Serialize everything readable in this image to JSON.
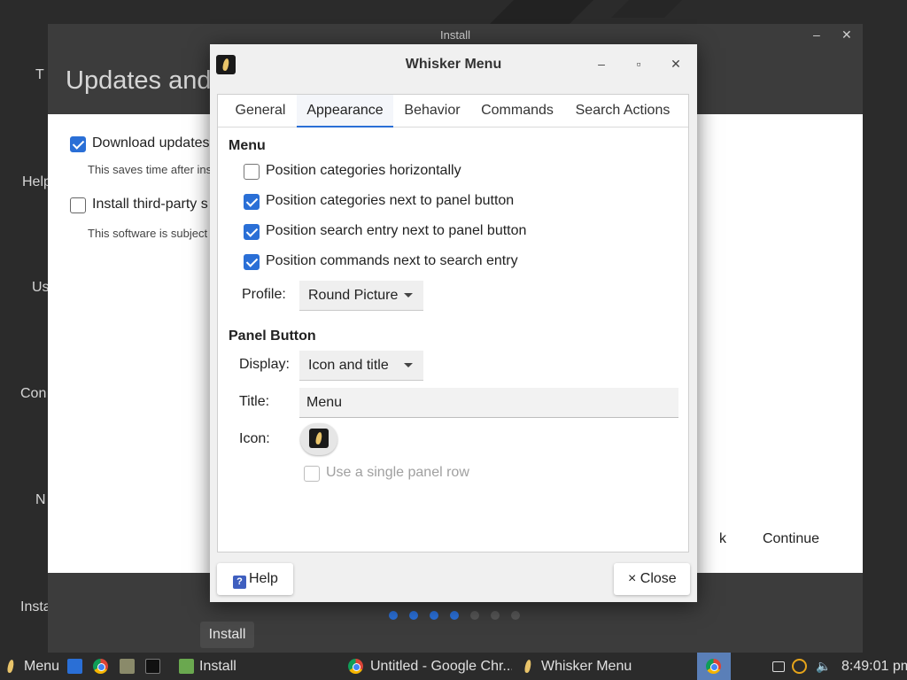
{
  "install_window": {
    "title": "Install",
    "minimize_glyph": "–",
    "close_glyph": "✕",
    "header": "Updates and",
    "options": [
      {
        "label": "Download updates",
        "checked": true,
        "desc": "This saves time after ins"
      },
      {
        "label": "Install third-party s",
        "checked": false,
        "desc": "This software is subject"
      }
    ],
    "back_label": "k",
    "continue_label": "Continue",
    "progress": {
      "total": 7,
      "current": 4
    }
  },
  "sidebar_fragments": [
    "T",
    "Help",
    "Us",
    "Con",
    "N",
    "Insta"
  ],
  "tooltip": "Install",
  "dialog": {
    "title": "Whisker Menu",
    "minimize_glyph": "–",
    "maximize_glyph": "▫",
    "close_glyph": "✕",
    "tabs": [
      "General",
      "Appearance",
      "Behavior",
      "Commands",
      "Search Actions"
    ],
    "active_tab": "Appearance",
    "menu_section": {
      "heading": "Menu",
      "options": [
        {
          "label": "Position categories horizontally",
          "checked": false
        },
        {
          "label": "Position categories next to panel button",
          "checked": true
        },
        {
          "label": "Position search entry next to panel button",
          "checked": true
        },
        {
          "label": "Position commands next to search entry",
          "checked": true
        }
      ],
      "profile_label": "Profile:",
      "profile_value": "Round Picture"
    },
    "panel_section": {
      "heading": "Panel Button",
      "display_label": "Display:",
      "display_value": "Icon and title",
      "title_label": "Title:",
      "title_value": "Menu",
      "icon_label": "Icon:",
      "single_row_label": "Use a single panel row",
      "single_row_checked": false
    },
    "help_glyph": "?",
    "help_label": "Help",
    "close_label": "× Close"
  },
  "taskbar": {
    "menu_label": "Menu",
    "tasks": [
      {
        "label": "Install"
      },
      {
        "label": "Untitled - Google Chr..."
      },
      {
        "label": "Whisker Menu"
      }
    ],
    "clock": "8:49:01 pm"
  }
}
